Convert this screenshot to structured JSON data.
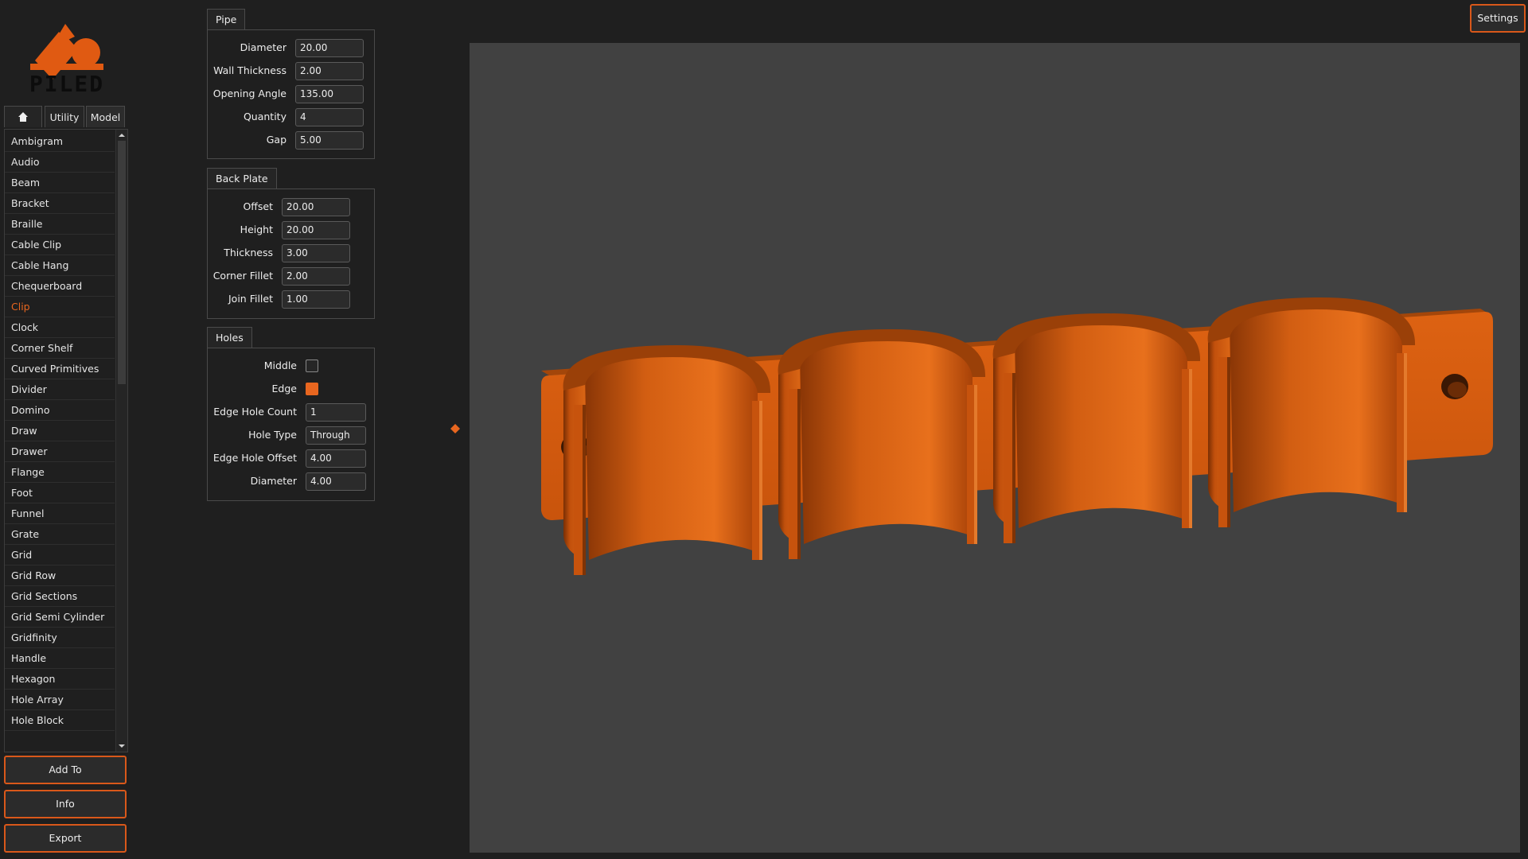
{
  "app": {
    "logo_text": "PILED",
    "accent_color": "#e8661f",
    "logo_color": "#e05a12"
  },
  "tabs": [
    {
      "label": "",
      "icon": "home-icon"
    },
    {
      "label": "Utility"
    },
    {
      "label": "Model"
    }
  ],
  "model_list": [
    "Ambigram",
    "Audio",
    "Beam",
    "Bracket",
    "Braille",
    "Cable Clip",
    "Cable Hang",
    "Chequerboard",
    "Clip",
    "Clock",
    "Corner Shelf",
    "Curved Primitives",
    "Divider",
    "Domino",
    "Draw",
    "Drawer",
    "Flange",
    "Foot",
    "Funnel",
    "Grate",
    "Grid",
    "Grid Row",
    "Grid Sections",
    "Grid Semi Cylinder",
    "Gridfinity",
    "Handle",
    "Hexagon",
    "Hole Array",
    "Hole Block"
  ],
  "selected_model": "Clip",
  "actions": {
    "add_to": "Add To",
    "info": "Info",
    "export": "Export",
    "settings": "Settings"
  },
  "pipe": {
    "title": "Pipe",
    "fields": [
      {
        "label": "Diameter",
        "value": "20.00"
      },
      {
        "label": "Wall Thickness",
        "value": "2.00"
      },
      {
        "label": "Opening Angle",
        "value": "135.00"
      },
      {
        "label": "Quantity",
        "value": "4"
      },
      {
        "label": "Gap",
        "value": "5.00"
      }
    ]
  },
  "back_plate": {
    "title": "Back Plate",
    "fields": [
      {
        "label": "Offset",
        "value": "20.00"
      },
      {
        "label": "Height",
        "value": "20.00"
      },
      {
        "label": "Thickness",
        "value": "3.00"
      },
      {
        "label": "Corner Fillet",
        "value": "2.00"
      },
      {
        "label": "Join Fillet",
        "value": "1.00"
      }
    ]
  },
  "holes": {
    "title": "Holes",
    "middle": {
      "label": "Middle",
      "checked": false
    },
    "edge": {
      "label": "Edge",
      "checked": true
    },
    "fields": [
      {
        "label": "Edge Hole Count",
        "value": "1"
      },
      {
        "label": "Hole Type",
        "value": "Through"
      },
      {
        "label": "Edge Hole Offset",
        "value": "4.00"
      },
      {
        "label": "Diameter",
        "value": "4.00"
      }
    ]
  },
  "viewport": {
    "background": "#414141",
    "model_color": "#d65a0f",
    "clip_count": 4
  }
}
